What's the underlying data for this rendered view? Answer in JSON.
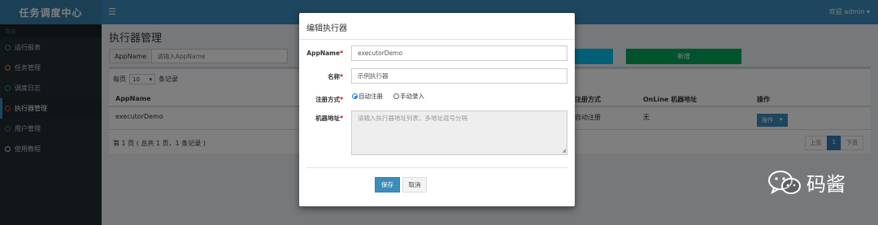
{
  "app": {
    "title": "任务调度中心"
  },
  "sidebar": {
    "header": "导航",
    "items": [
      {
        "label": "运行报表",
        "color": "#3c8dbc",
        "active": false
      },
      {
        "label": "任务管理",
        "color": "#f39c12",
        "active": false
      },
      {
        "label": "调度日志",
        "color": "#00a65a",
        "active": false
      },
      {
        "label": "执行器管理",
        "color": "#dd4b39",
        "active": true
      },
      {
        "label": "用户管理",
        "color": "#605ca8",
        "active": false
      },
      {
        "label": "使用教程",
        "color": "#d2d6de",
        "active": false
      }
    ]
  },
  "header": {
    "menu_icon": "hamburger-icon",
    "user": "欢迎 admin ▾"
  },
  "page": {
    "title": "执行器管理",
    "search_addon": "AppName",
    "search_placeholder": "请输入AppName",
    "add_label": "新增",
    "page_size_prefix": "每页",
    "page_size_value": "10",
    "page_size_suffix": "条记录",
    "columns": {
      "appname": "AppName",
      "reg_type": "注册方式",
      "online": "OnLine 机器地址",
      "ops": "操作"
    },
    "row": {
      "appname": "executorDemo",
      "reg_type": "自动注册",
      "online": "无",
      "op_label": "操作",
      "op_caret": "▾"
    },
    "footer_info": "第 1 页 ( 总共 1 页，1 条记录 )",
    "pager": {
      "prev": "上页",
      "current": "1",
      "next": "下页"
    }
  },
  "modal": {
    "title": "编辑执行器",
    "appname_label": "AppName",
    "appname_value": "executorDemo",
    "name_label": "名称",
    "name_value": "示例执行器",
    "reg_label": "注册方式",
    "reg_auto": "自动注册",
    "reg_manual": "手动录入",
    "addr_label": "机器地址",
    "addr_placeholder": "请输入执行器地址列表，多地址逗号分隔",
    "required_mark": "*",
    "save_label": "保存",
    "cancel_label": "取消"
  },
  "watermark": {
    "text": "码酱",
    "icon": "wechat-icon"
  }
}
